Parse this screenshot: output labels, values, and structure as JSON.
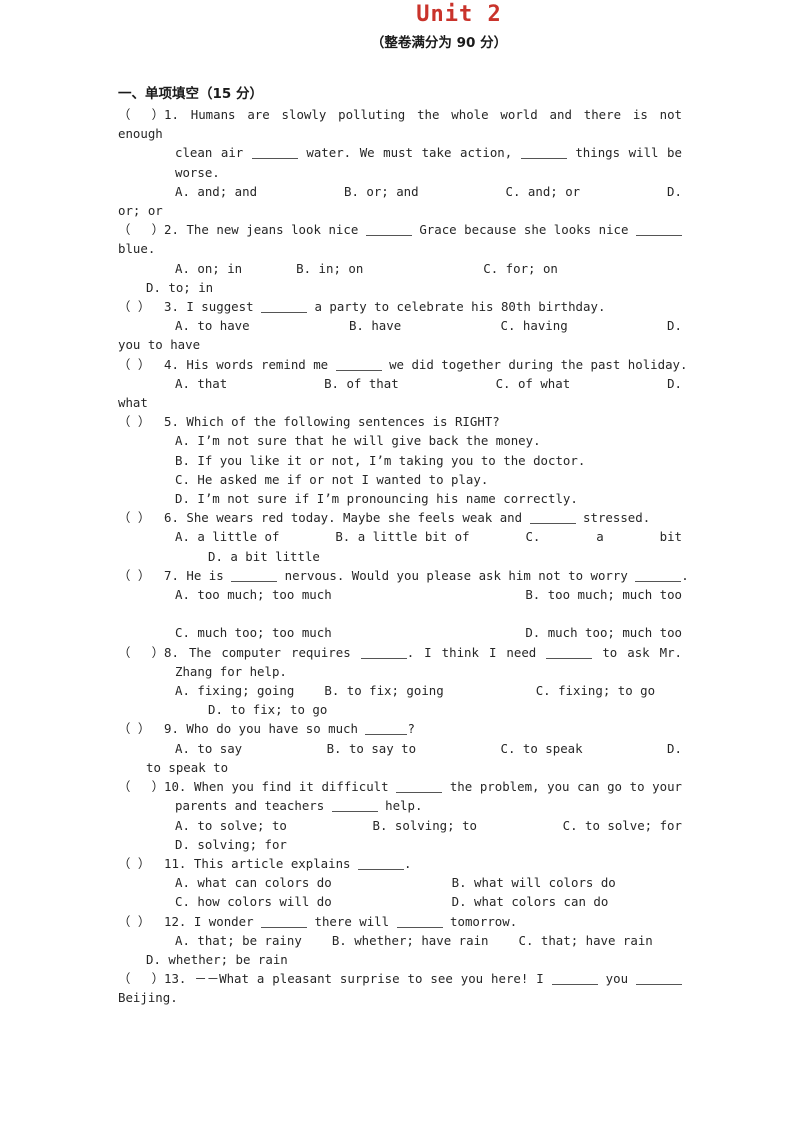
{
  "document": {
    "title": "Unit 2",
    "title_color": "#c9332b",
    "subtitle": "（整卷满分为 90 分）",
    "section_heading": "一、单项填空（15 分）"
  },
  "questions": [
    {
      "marker": "（    ）",
      "number": "1.",
      "stem_lines": [
        "Humans are slowly polluting the whole world and there is not enough",
        "clean air ______ water. We must take action, ______ things will be",
        "worse."
      ],
      "options_rows": [
        [
          "A. and; and",
          "B. or; and",
          "C. and; or",
          "D."
        ],
        [
          "or; or"
        ]
      ]
    },
    {
      "marker": "（    ）",
      "number": "2.",
      "stem_lines": [
        "The new jeans look nice ______ Grace because she looks nice ______",
        "blue."
      ],
      "options_rows": [
        [
          "A. on; in",
          "B. in; on",
          "C. for; on"
        ],
        [
          "D. to; in"
        ]
      ]
    },
    {
      "marker": "（    ）",
      "number": "3.",
      "stem_lines": [
        "I suggest ______ a party to celebrate his 80th birthday."
      ],
      "options_rows": [
        [
          "A. to have",
          "B. have",
          "C. having",
          "D."
        ],
        [
          "you to have"
        ]
      ]
    },
    {
      "marker": "（    ）",
      "number": "4.",
      "stem_lines": [
        "His words remind me ______ we did together during the past holiday."
      ],
      "options_rows": [
        [
          "A. that",
          "B. of that",
          "C. of what",
          "D."
        ],
        [
          "what"
        ]
      ]
    },
    {
      "marker": "（    ）",
      "number": "5.",
      "stem_lines": [
        "Which of the following sentences is RIGHT?"
      ],
      "options_rows": [
        [
          "A. I’m not sure that he will give back the money."
        ],
        [
          "B. If you like it or not, I’m taking you to the doctor."
        ],
        [
          "C. He asked me if or not I wanted to play."
        ],
        [
          "D. I’m not sure if I’m pronouncing his name correctly."
        ]
      ]
    },
    {
      "marker": "（    ）",
      "number": "6.",
      "stem_lines": [
        "She wears red today. Maybe she feels weak and ______ stressed."
      ],
      "options_rows": [
        [
          "A. a little of",
          "B. a little bit of",
          "C.",
          "a",
          "bit"
        ],
        [
          "D. a bit little"
        ]
      ]
    },
    {
      "marker": "（    ）",
      "number": "7.",
      "stem_lines": [
        "He is ______ nervous. Would you please ask him not to worry ______."
      ],
      "options_rows": [
        [
          "A. too much; too much",
          "B.  too  much;  much  too"
        ],
        [
          ""
        ],
        [
          "C. much too; too much",
          "D. much too; much too"
        ]
      ]
    },
    {
      "marker": "（    ）",
      "number": "8.",
      "stem_lines": [
        "The computer requires ______. I think I need ______ to ask Mr.",
        "Zhang for help."
      ],
      "options_rows": [
        [
          "A. fixing; going",
          "B. to fix; going",
          "C. fixing; to go"
        ],
        [
          "D. to fix; to go"
        ]
      ]
    },
    {
      "marker": "（    ）",
      "number": "9.",
      "stem_lines": [
        "Who do you have so much ______?"
      ],
      "options_rows": [
        [
          "A. to say",
          "B. to say to",
          "C. to speak",
          "D."
        ],
        [
          "to speak to"
        ]
      ]
    },
    {
      "marker": "（    ）",
      "number": "10.",
      "stem_lines": [
        "When you find it difficult ______ the problem, you can go to your",
        "parents and teachers ______ help."
      ],
      "options_rows": [
        [
          "A. to solve; to",
          "B. solving; to",
          "C. to solve; for"
        ],
        [
          "D. solving; for"
        ]
      ]
    },
    {
      "marker": "（    ）",
      "number": "11.",
      "stem_lines": [
        "This article explains ______."
      ],
      "options_rows": [
        [
          "A. what can colors do",
          "B. what will colors do"
        ],
        [
          "C. how colors will do",
          "D. what colors can do"
        ]
      ]
    },
    {
      "marker": "（    ）",
      "number": "12.",
      "stem_lines": [
        "I wonder ______ there will ______ tomorrow."
      ],
      "options_rows": [
        [
          "A. that; be rainy",
          "B. whether; have rain",
          "C. that; have rain"
        ],
        [
          "D. whether; be rain"
        ]
      ]
    },
    {
      "marker": "（    ）",
      "number": "13.",
      "stem_lines": [
        "－－What a pleasant surprise to see you here! I ______ you ______",
        "Beijing."
      ],
      "options_rows": []
    }
  ],
  "text": {
    "q1_l1": "Humans are slowly polluting the whole world and there is not enough",
    "q1_l2a": "clean air",
    "q1_l2b": "water. We must take action,",
    "q1_l2c": "things will be",
    "q1_l3": "worse.",
    "q1_oA": "A. and; and",
    "q1_oB": "B. or; and",
    "q1_oC": "C. and; or",
    "q1_oD": "D.",
    "q1_oD2": "or; or",
    "q2_l1a": "The new jeans look nice",
    "q2_l1b": "Grace because she looks nice",
    "q2_l2": "blue.",
    "q2_oA": "A. on; in",
    "q2_oB": "B. in; on",
    "q2_oC": "C. for; on",
    "q2_oD": "D. to; in",
    "q3_l1a": "I suggest",
    "q3_l1b": "a party to celebrate his 80th birthday.",
    "q3_oA": "A. to have",
    "q3_oB": "B. have",
    "q3_oC": "C. having",
    "q3_oD": "D.",
    "q3_oD2": "you to have",
    "q4_l1a": "His words remind me",
    "q4_l1b": "we did together during the past holiday.",
    "q4_oA": "A. that",
    "q4_oB": "B. of that",
    "q4_oC": "C. of what",
    "q4_oD": "D.",
    "q4_oD2": "what",
    "q5_l1": "Which of the following sentences is RIGHT?",
    "q5_oA": "A. I’m not sure that he will give back the money.",
    "q5_oB": "B. If you like it or not, I’m taking you to the doctor.",
    "q5_oC": "C. He asked me if or not I wanted to play.",
    "q5_oD": "D. I’m not sure if I’m pronouncing his name correctly.",
    "q6_l1a": "She wears red today. Maybe she feels weak and",
    "q6_l1b": "stressed.",
    "q6_oA": "A. a little of",
    "q6_oB": "B. a little bit of",
    "q6_oC1": "C.",
    "q6_oC2": "a",
    "q6_oC3": "bit",
    "q6_oD": "D. a bit little",
    "q7_l1a": "He is",
    "q7_l1b": "nervous. Would you please ask him not to worry",
    "q7_l1c": ".",
    "q7_oA": "A. too much; too much",
    "q7_oB": "B.  too  much;  much  too",
    "q7_oC": "C. much too; too much",
    "q7_oD": "D. much too; much too",
    "q8_l1a": "The computer requires",
    "q8_l1b": ". I think I need",
    "q8_l1c": "to ask Mr.",
    "q8_l2": "Zhang for help.",
    "q8_oA": "A. fixing; going",
    "q8_oB": "B. to fix; going",
    "q8_oC": "C. fixing; to go",
    "q8_oD": "D. to fix; to go",
    "q9_l1a": "Who do you have so much",
    "q9_l1b": "?",
    "q9_oA": "A. to say",
    "q9_oB": "B. to say to",
    "q9_oC": "C. to speak",
    "q9_oD": "D.",
    "q9_oD2": "to speak to",
    "q10_l1a": "When you find it difficult",
    "q10_l1b": "the problem, you can go to your",
    "q10_l2a": "parents and teachers",
    "q10_l2b": "help.",
    "q10_oA": "A. to solve; to",
    "q10_oB": "B. solving; to",
    "q10_oC": "C. to solve; for",
    "q10_oD": "D. solving; for",
    "q11_l1a": "This article explains",
    "q11_l1b": ".",
    "q11_oA": "A. what can colors do",
    "q11_oB": "B. what will colors do",
    "q11_oC": "C. how colors will do",
    "q11_oD": "D. what colors can do",
    "q12_l1a": "I wonder",
    "q12_l1b": "there will",
    "q12_l1c": "tomorrow.",
    "q12_oA": "A. that; be rainy",
    "q12_oB": "B. whether; have rain",
    "q12_oC": "C. that; have rain",
    "q12_oD": "D. whether; be rain",
    "q13_l1a": "－－What a pleasant surprise to see you here! I",
    "q13_l1b": "you",
    "q13_l2": "Beijing.",
    "marker": "（    ）",
    "n1": "1.",
    "n2": "2.",
    "n3": "3.",
    "n4": "4.",
    "n5": "5.",
    "n6": "6.",
    "n7": "7.",
    "n8": "8.",
    "n9": "9.",
    "n10": "10.",
    "n11": "11.",
    "n12": "12.",
    "n13": "13."
  }
}
